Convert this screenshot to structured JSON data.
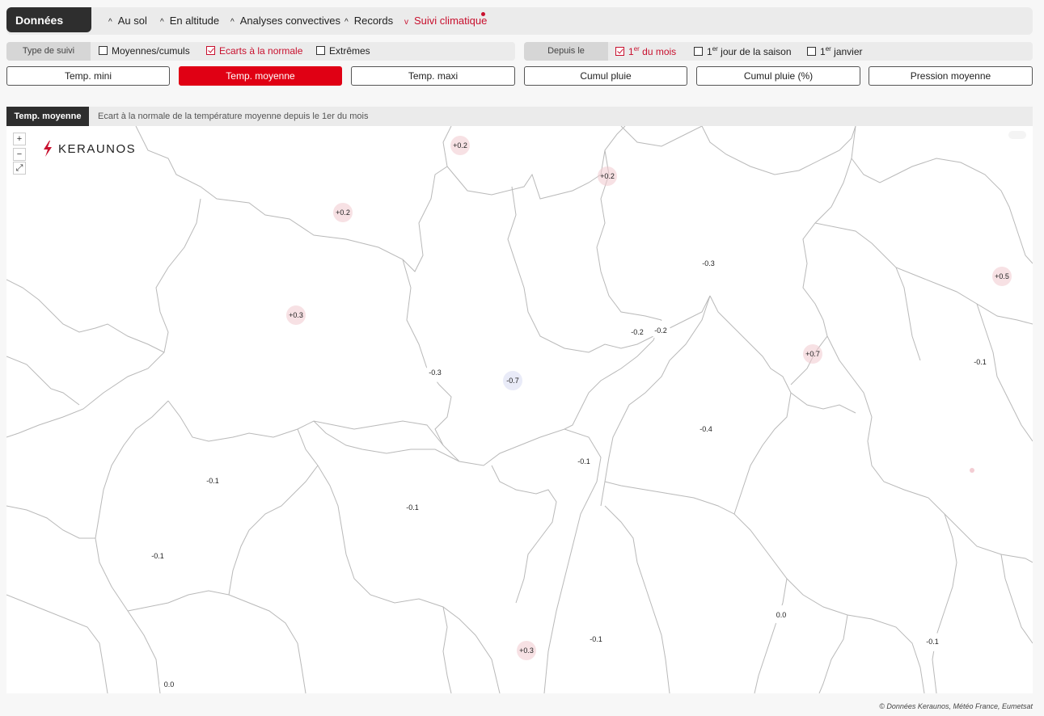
{
  "header": {
    "brand": "Données",
    "nav": [
      {
        "caret": "^",
        "label": "Au sol"
      },
      {
        "caret": "^",
        "label": "En altitude"
      },
      {
        "caret": "^",
        "label": "Analyses convectives"
      },
      {
        "caret": "^",
        "label": "Records"
      },
      {
        "caret": "v",
        "label": "Suivi climatique"
      }
    ]
  },
  "type_suivi": {
    "label": "Type de suivi",
    "options": [
      {
        "label": "Moyennes/cumuls",
        "checked": false
      },
      {
        "label": "Ecarts à la normale",
        "checked": true
      },
      {
        "label": "Extrêmes",
        "checked": false
      }
    ]
  },
  "depuis": {
    "label": "Depuis le",
    "options": [
      {
        "sup": "er",
        "pre": "1",
        "label": " du mois",
        "checked": true
      },
      {
        "sup": "er",
        "pre": "1",
        "label": " jour de la saison",
        "checked": false
      },
      {
        "sup": "er",
        "pre": "1",
        "label": " janvier",
        "checked": false
      }
    ]
  },
  "parameters": [
    {
      "label": "Temp. mini",
      "active": false
    },
    {
      "label": "Temp. moyenne",
      "active": true
    },
    {
      "label": "Temp. maxi",
      "active": false
    },
    {
      "label": "Cumul pluie",
      "active": false
    },
    {
      "label": "Cumul pluie (%)",
      "active": false
    },
    {
      "label": "Pression moyenne",
      "active": false
    }
  ],
  "map": {
    "title": "Temp. moyenne",
    "description": "Ecart à la normale de la température moyenne depuis le 1er du mois",
    "zoom_in": "+",
    "zoom_out": "−",
    "fullscreen": "⤢",
    "logo_text": "KERAUNOS",
    "brand_color": "#c8102e",
    "values": [
      "+0.2",
      "+0.2",
      "+0.2",
      "+0.3",
      "-0.3",
      "-0.3",
      "-0.7",
      "-0.2",
      "-0.2",
      "+0.5",
      "+0.7",
      "-0.1",
      "-0.4",
      "-0.1",
      "-0.1",
      "-0.1",
      "-0.1",
      "0.0",
      "-0.1",
      "+0.3",
      "-0.1",
      "0.0"
    ]
  },
  "credit": "© Données Keraunos, Météo France, Eumetsat"
}
